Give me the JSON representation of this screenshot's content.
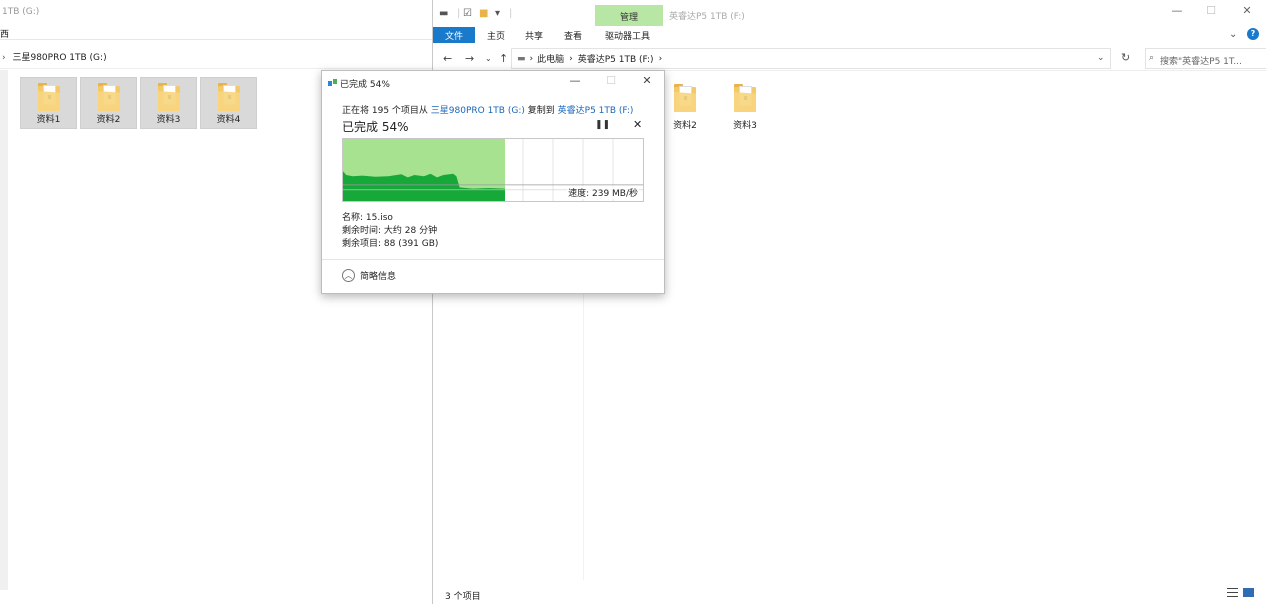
{
  "left_window": {
    "title": "1TB (G:)",
    "ribbon_text": "西",
    "breadcrumb": "三星980PRO 1TB (G:)",
    "folders": [
      "资料1",
      "资料2",
      "资料3",
      "资料4"
    ]
  },
  "right_window": {
    "manage_tab": "管理",
    "title": "英睿达P5 1TB (F:)",
    "ribbon_tabs": [
      "文件",
      "主页",
      "共享",
      "查看",
      "驱动器工具"
    ],
    "breadcrumb": [
      "此电脑",
      "英睿达P5 1TB (F:)"
    ],
    "search_placeholder": "搜索\"英睿达P5 1T...",
    "folders": [
      "资料2",
      "资料3"
    ],
    "status": "3 个项目"
  },
  "copy_dialog": {
    "title": "已完成 54%",
    "copy_prefix": "正在将 195 个项目从",
    "source": "三星980PRO 1TB (G:)",
    "copy_mid": "复制到",
    "destination": "英睿达P5 1TB (F:)",
    "percent_label": "已完成 54%",
    "progress": 0.54,
    "speed_label": "速度: 239 MB/秒",
    "name_line": "名称: 15.iso",
    "time_line": "剩余时间: 大约 28 分钟",
    "items_line": "剩余项目: 88 (391 GB)",
    "less_details": "简略信息"
  },
  "colors": {
    "accent": "#1979ca",
    "manage_tab": "#b8e6a4",
    "graph_fill": "#a6e28f",
    "graph_speed": "#17a83a",
    "folder": "#f3c969",
    "link": "#1a66b8"
  }
}
